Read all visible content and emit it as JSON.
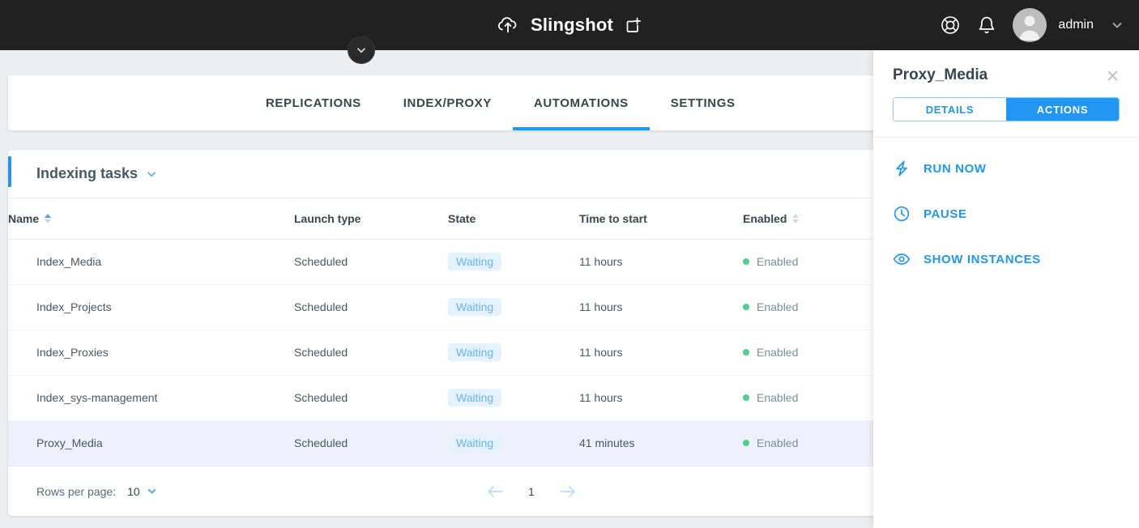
{
  "topbar": {
    "brand": "Slingshot",
    "brand_icon": "cloud-upload-icon",
    "new_window_icon": "add-window-icon",
    "support_icon": "lifebuoy-icon",
    "notifications_icon": "bell-icon",
    "avatar_icon": "user-avatar",
    "username": "admin",
    "user_chevron_icon": "chevron-down-icon",
    "collapse_icon": "chevron-down-icon"
  },
  "tabs": [
    {
      "label": "REPLICATIONS",
      "active": false
    },
    {
      "label": "INDEX/PROXY",
      "active": false
    },
    {
      "label": "AUTOMATIONS",
      "active": true
    },
    {
      "label": "SETTINGS",
      "active": false
    }
  ],
  "section": {
    "title": "Indexing tasks",
    "chevron_icon": "chevron-down-icon"
  },
  "table": {
    "columns": [
      {
        "label": "Name",
        "sortable": true,
        "sort": "asc"
      },
      {
        "label": "Launch type",
        "sortable": false,
        "sort": "none"
      },
      {
        "label": "State",
        "sortable": false,
        "sort": "none"
      },
      {
        "label": "Time to start",
        "sortable": false,
        "sort": "none"
      },
      {
        "label": "Enabled",
        "sortable": true,
        "sort": "none"
      }
    ],
    "rows": [
      {
        "name": "Index_Media",
        "launch_type": "Scheduled",
        "state": "Waiting",
        "time_to_start": "11 hours",
        "enabled": "Enabled",
        "selected": false
      },
      {
        "name": "Index_Projects",
        "launch_type": "Scheduled",
        "state": "Waiting",
        "time_to_start": "11 hours",
        "enabled": "Enabled",
        "selected": false
      },
      {
        "name": "Index_Proxies",
        "launch_type": "Scheduled",
        "state": "Waiting",
        "time_to_start": "11 hours",
        "enabled": "Enabled",
        "selected": false
      },
      {
        "name": "Index_sys-management",
        "launch_type": "Scheduled",
        "state": "Waiting",
        "time_to_start": "11 hours",
        "enabled": "Enabled",
        "selected": false
      },
      {
        "name": "Proxy_Media",
        "launch_type": "Scheduled",
        "state": "Waiting",
        "time_to_start": "41 minutes",
        "enabled": "Enabled",
        "selected": true
      }
    ]
  },
  "pagination": {
    "rows_per_page_label": "Rows per page:",
    "rows_per_page_value": "10",
    "rows_per_page_chevron_icon": "chevron-down-icon",
    "prev_icon": "arrow-left-icon",
    "next_icon": "arrow-right-icon",
    "page": "1"
  },
  "drawer": {
    "title": "Proxy_Media",
    "close_icon": "close-icon",
    "segments": [
      {
        "label": "DETAILS",
        "active": false
      },
      {
        "label": "ACTIONS",
        "active": true
      }
    ],
    "actions": [
      {
        "label": "RUN NOW",
        "icon": "lightning-bolt-icon"
      },
      {
        "label": "PAUSE",
        "icon": "clock-icon"
      },
      {
        "label": "SHOW INSTANCES",
        "icon": "eye-icon"
      }
    ]
  },
  "colors": {
    "accent": "#2196f3",
    "topbar_bg": "#212121",
    "page_bg": "#eceff1",
    "badge_bg": "#e3f2fd",
    "badge_text": "#64b5f6",
    "enabled_dot": "#4ecf8f",
    "selected_row_bg": "#eef0fa"
  }
}
